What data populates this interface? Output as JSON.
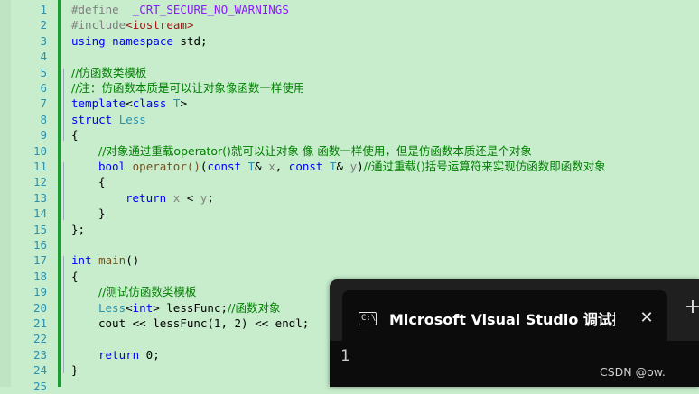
{
  "editor": {
    "line_numbers": [
      "1",
      "2",
      "3",
      "4",
      "5",
      "6",
      "7",
      "8",
      "9",
      "10",
      "11",
      "12",
      "13",
      "14",
      "15",
      "16",
      "17",
      "18",
      "19",
      "20",
      "21",
      "22",
      "23",
      "24",
      "25"
    ],
    "lines": [
      {
        "n": "1",
        "tokens": [
          {
            "t": "#define",
            "c": "pp"
          },
          {
            "t": "  ",
            "c": ""
          },
          {
            "t": "_CRT_SECURE_NO_WARNINGS",
            "c": "mac"
          }
        ]
      },
      {
        "n": "2",
        "tokens": [
          {
            "t": "#include",
            "c": "pp"
          },
          {
            "t": "<iostream>",
            "c": "str"
          }
        ]
      },
      {
        "n": "3",
        "tokens": [
          {
            "t": "using",
            "c": "kw"
          },
          {
            "t": " ",
            "c": ""
          },
          {
            "t": "namespace",
            "c": "kw"
          },
          {
            "t": " std;",
            "c": ""
          }
        ]
      },
      {
        "n": "4",
        "tokens": []
      },
      {
        "n": "5",
        "tokens": [
          {
            "t": "//仿函数类模板",
            "c": "cm"
          }
        ]
      },
      {
        "n": "6",
        "tokens": [
          {
            "t": "//注：仿函数本质是可以让对象像函数一样使用",
            "c": "cm"
          }
        ]
      },
      {
        "n": "7",
        "tokens": [
          {
            "t": "template",
            "c": "kw"
          },
          {
            "t": "<",
            "c": ""
          },
          {
            "t": "class",
            "c": "kw"
          },
          {
            "t": " ",
            "c": ""
          },
          {
            "t": "T",
            "c": "ty"
          },
          {
            "t": ">",
            "c": ""
          }
        ]
      },
      {
        "n": "8",
        "tokens": [
          {
            "t": "struct",
            "c": "kw"
          },
          {
            "t": " ",
            "c": ""
          },
          {
            "t": "Less",
            "c": "ty"
          }
        ]
      },
      {
        "n": "9",
        "tokens": [
          {
            "t": "{",
            "c": ""
          }
        ]
      },
      {
        "n": "10",
        "indent": 1,
        "tokens": [
          {
            "t": "//对象通过重载operator()就可以让对象 像 函数一样使用，但是仿函数本质还是个对象",
            "c": "cm"
          }
        ]
      },
      {
        "n": "11",
        "indent": 1,
        "tokens": [
          {
            "t": "bool",
            "c": "kw"
          },
          {
            "t": " ",
            "c": ""
          },
          {
            "t": "operator()",
            "c": "fn"
          },
          {
            "t": "(",
            "c": ""
          },
          {
            "t": "const",
            "c": "kw"
          },
          {
            "t": " ",
            "c": ""
          },
          {
            "t": "T",
            "c": "ty"
          },
          {
            "t": "& ",
            "c": ""
          },
          {
            "t": "x",
            "c": "pm"
          },
          {
            "t": ", ",
            "c": ""
          },
          {
            "t": "const",
            "c": "kw"
          },
          {
            "t": " ",
            "c": ""
          },
          {
            "t": "T",
            "c": "ty"
          },
          {
            "t": "& ",
            "c": ""
          },
          {
            "t": "y",
            "c": "pm"
          },
          {
            "t": ")",
            "c": ""
          },
          {
            "t": "//通过重载()括号运算符来实现仿函数即函数对象",
            "c": "cm"
          }
        ]
      },
      {
        "n": "12",
        "indent": 1,
        "tokens": [
          {
            "t": "{",
            "c": ""
          }
        ]
      },
      {
        "n": "13",
        "indent": 2,
        "tokens": [
          {
            "t": "return",
            "c": "kw"
          },
          {
            "t": " ",
            "c": ""
          },
          {
            "t": "x",
            "c": "pm"
          },
          {
            "t": " < ",
            "c": ""
          },
          {
            "t": "y",
            "c": "pm"
          },
          {
            "t": ";",
            "c": ""
          }
        ]
      },
      {
        "n": "14",
        "indent": 1,
        "tokens": [
          {
            "t": "}",
            "c": ""
          }
        ]
      },
      {
        "n": "15",
        "tokens": [
          {
            "t": "};",
            "c": ""
          }
        ]
      },
      {
        "n": "16",
        "tokens": []
      },
      {
        "n": "17",
        "tokens": [
          {
            "t": "int",
            "c": "kw"
          },
          {
            "t": " ",
            "c": ""
          },
          {
            "t": "main",
            "c": "fn"
          },
          {
            "t": "()",
            "c": ""
          }
        ]
      },
      {
        "n": "18",
        "tokens": [
          {
            "t": "{",
            "c": ""
          }
        ]
      },
      {
        "n": "19",
        "indent": 1,
        "tokens": [
          {
            "t": "//测试仿函数类模板",
            "c": "cm"
          }
        ]
      },
      {
        "n": "20",
        "indent": 1,
        "tokens": [
          {
            "t": "Less",
            "c": "ty"
          },
          {
            "t": "<",
            "c": ""
          },
          {
            "t": "int",
            "c": "kw"
          },
          {
            "t": "> lessFunc;",
            "c": ""
          },
          {
            "t": "//函数对象",
            "c": "cm"
          }
        ]
      },
      {
        "n": "21",
        "indent": 1,
        "tokens": [
          {
            "t": "cout << lessFunc(1, 2) << endl;",
            "c": ""
          }
        ]
      },
      {
        "n": "22",
        "tokens": []
      },
      {
        "n": "23",
        "indent": 1,
        "tokens": [
          {
            "t": "return",
            "c": "kw"
          },
          {
            "t": " 0;",
            "c": ""
          }
        ]
      },
      {
        "n": "24",
        "tokens": [
          {
            "t": "}",
            "c": ""
          }
        ]
      },
      {
        "n": "25",
        "tokens": []
      }
    ]
  },
  "console": {
    "title": "Microsoft Visual Studio 调试控制台",
    "close_glyph": "✕",
    "new_tab_glyph": "+",
    "icon_glyph": "C:\\",
    "output": "1"
  },
  "watermark": "CSDN @ow."
}
